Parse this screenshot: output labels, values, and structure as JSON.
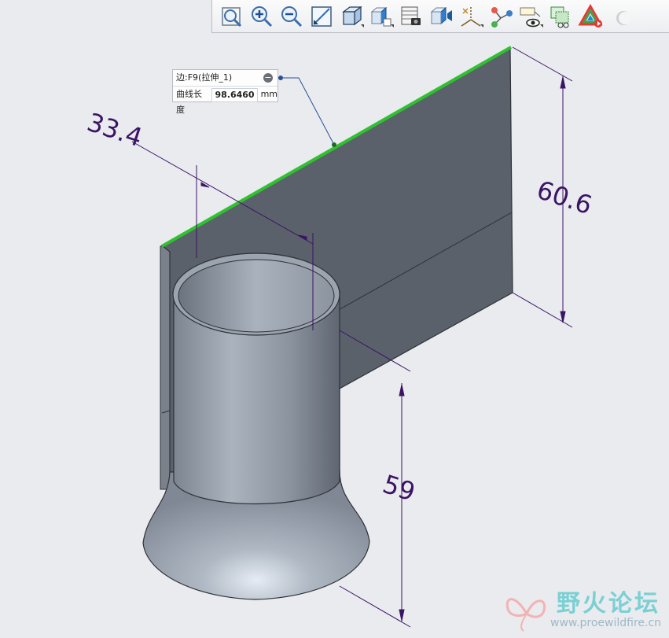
{
  "toolbar": {
    "buttons": [
      {
        "name": "refit-icon"
      },
      {
        "name": "zoom-in-icon"
      },
      {
        "name": "zoom-out-icon"
      },
      {
        "name": "repaint-icon"
      },
      {
        "name": "display-style-icon"
      },
      {
        "name": "saved-orientations-icon"
      },
      {
        "name": "view-manager-icon"
      },
      {
        "name": "section-view-icon"
      },
      {
        "name": "datum-display-icon"
      },
      {
        "name": "coordinate-system-icon"
      },
      {
        "name": "spin-center-icon"
      },
      {
        "name": "annotation-display-icon"
      },
      {
        "name": "layer-icon"
      },
      {
        "name": "appearance-gallery-icon"
      }
    ]
  },
  "measurement": {
    "edge_label": "边:F9(拉伸_1)",
    "length_label": "曲线长度",
    "length_value": "98.6460",
    "unit": "mm"
  },
  "dimensions": {
    "d1": "33.4",
    "d2": "60.6",
    "d3": "59"
  },
  "watermark": {
    "title": "野火论坛",
    "url": "www.proewildfire.cn"
  },
  "colors": {
    "background": "#e9ebef",
    "plate": "#5a616b",
    "highlight_edge": "#2fc22f",
    "dimension": "#3b1464",
    "cylinder": "#8f97a3"
  }
}
